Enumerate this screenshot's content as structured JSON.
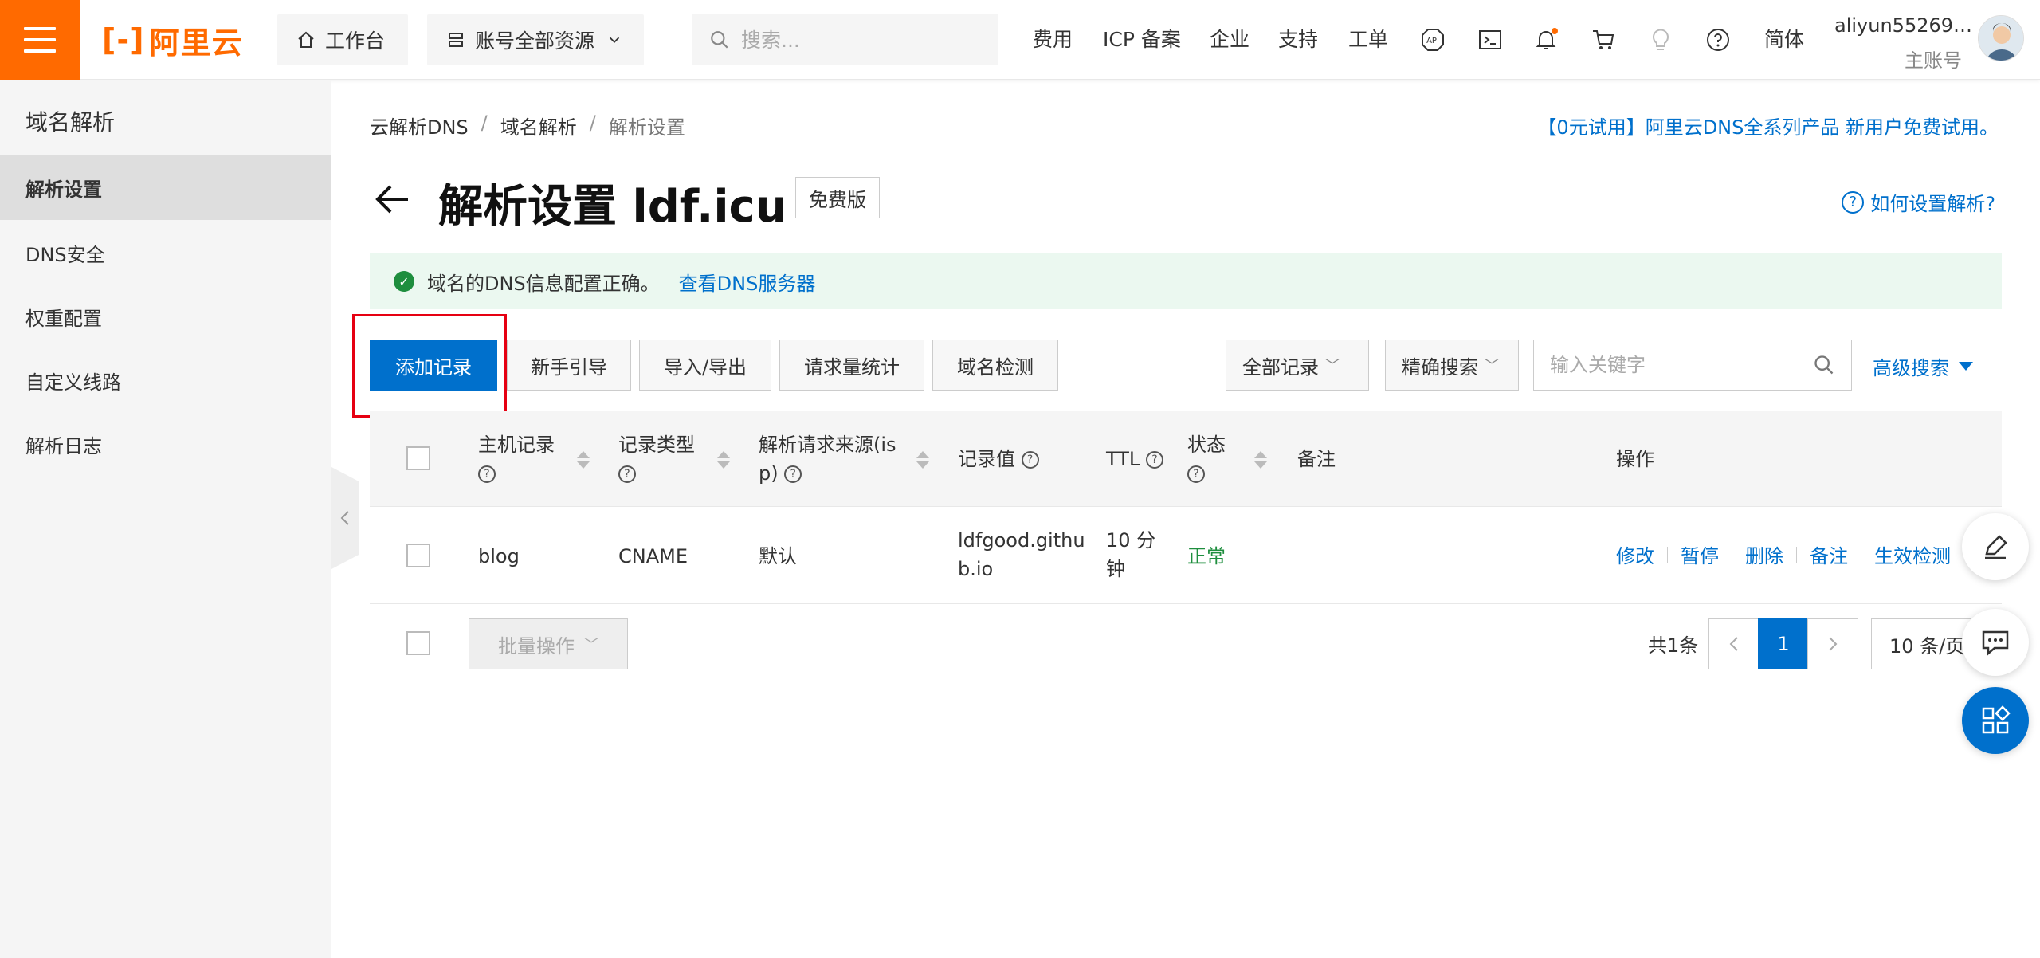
{
  "header": {
    "logo_text": "阿里云",
    "workbench_label": "工作台",
    "resources_label": "账号全部资源",
    "search_placeholder": "搜索...",
    "nav": [
      "费用",
      "ICP 备案",
      "企业",
      "支持",
      "工单"
    ],
    "lang": "简体",
    "user_name": "aliyun55269…",
    "user_role": "主账号",
    "accent": "#ff6a00"
  },
  "sidebar": {
    "title": "域名解析",
    "items": [
      {
        "label": "解析设置",
        "active": true
      },
      {
        "label": "DNS安全",
        "active": false
      },
      {
        "label": "权重配置",
        "active": false
      },
      {
        "label": "自定义线路",
        "active": false
      },
      {
        "label": "解析日志",
        "active": false
      }
    ]
  },
  "breadcrumb": [
    "云解析DNS",
    "域名解析",
    "解析设置"
  ],
  "promo": "【0元试用】阿里云DNS全系列产品 新用户免费试用。",
  "page": {
    "title": "解析设置 ldf.icu",
    "badge": "免费版",
    "help": "如何设置解析?"
  },
  "alert": {
    "text": "域名的DNS信息配置正确。",
    "link": "查看DNS服务器"
  },
  "toolbar": {
    "add": "添加记录",
    "guide": "新手引导",
    "import": "导入/导出",
    "stats": "请求量统计",
    "check": "域名检测",
    "filter": "全部记录",
    "search_mode": "精确搜索",
    "keyword_placeholder": "输入关键字",
    "advanced": "高级搜索"
  },
  "table": {
    "columns": {
      "host": "主机记录",
      "type": "记录类型",
      "isp_line1": "解析请求来源(is",
      "isp_line2": "p)",
      "value": "记录值",
      "ttl": "TTL",
      "status": "状态",
      "remark": "备注",
      "ops": "操作"
    },
    "rows": [
      {
        "host": "blog",
        "type": "CNAME",
        "isp": "默认",
        "value_line1": "ldfgood.githu",
        "value_line2": "b.io",
        "ttl_line1": "10 分",
        "ttl_line2": "钟",
        "status": "正常",
        "remark": "",
        "ops": [
          "修改",
          "暂停",
          "删除",
          "备注",
          "生效检测"
        ]
      }
    ]
  },
  "footer": {
    "batch": "批量操作",
    "total": "共1条",
    "current_page": "1",
    "page_size": "10 条/页"
  }
}
